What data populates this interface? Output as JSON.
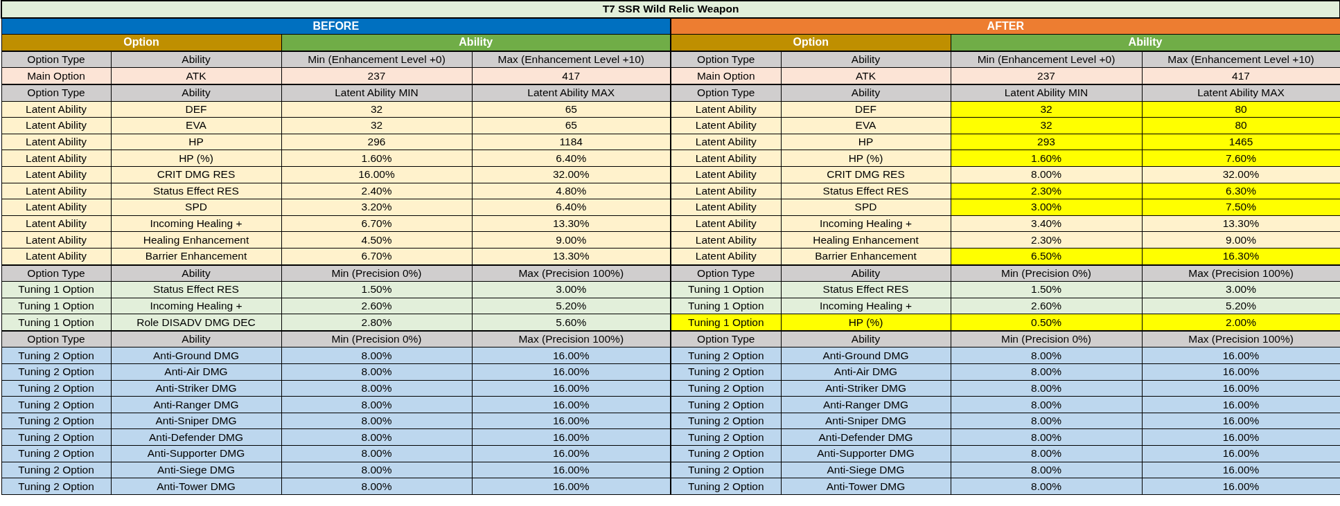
{
  "title": "T7 SSR Wild Relic Weapon",
  "panels": [
    {
      "label": "BEFORE",
      "color": "#0070c0",
      "groups": [
        {
          "label": "Option",
          "kind": "option"
        },
        {
          "label": "Ability",
          "kind": "ability"
        }
      ],
      "sections": [
        {
          "kind": "main",
          "header": [
            "Option Type",
            "Ability",
            "Min (Enhancement Level +0)",
            "Max (Enhancement Level +10)"
          ],
          "rows": [
            {
              "cells": [
                "Main Option",
                "ATK",
                "237",
                "417"
              ],
              "labels_highlighted": false,
              "values_highlighted": false
            }
          ]
        },
        {
          "kind": "latent",
          "header": [
            "Option Type",
            "Ability",
            "Latent Ability MIN",
            "Latent Ability MAX"
          ],
          "rows": [
            {
              "cells": [
                "Latent Ability",
                "DEF",
                "32",
                "65"
              ],
              "labels_highlighted": false,
              "values_highlighted": false
            },
            {
              "cells": [
                "Latent Ability",
                "EVA",
                "32",
                "65"
              ],
              "labels_highlighted": false,
              "values_highlighted": false
            },
            {
              "cells": [
                "Latent Ability",
                "HP",
                "296",
                "1184"
              ],
              "labels_highlighted": false,
              "values_highlighted": false
            },
            {
              "cells": [
                "Latent Ability",
                "HP (%)",
                "1.60%",
                "6.40%"
              ],
              "labels_highlighted": false,
              "values_highlighted": false
            },
            {
              "cells": [
                "Latent Ability",
                "CRIT DMG RES",
                "16.00%",
                "32.00%"
              ],
              "labels_highlighted": false,
              "values_highlighted": false
            },
            {
              "cells": [
                "Latent Ability",
                "Status Effect RES",
                "2.40%",
                "4.80%"
              ],
              "labels_highlighted": false,
              "values_highlighted": false
            },
            {
              "cells": [
                "Latent Ability",
                "SPD",
                "3.20%",
                "6.40%"
              ],
              "labels_highlighted": false,
              "values_highlighted": false
            },
            {
              "cells": [
                "Latent Ability",
                "Incoming Healing +",
                "6.70%",
                "13.30%"
              ],
              "labels_highlighted": false,
              "values_highlighted": false
            },
            {
              "cells": [
                "Latent Ability",
                "Healing Enhancement",
                "4.50%",
                "9.00%"
              ],
              "labels_highlighted": false,
              "values_highlighted": false
            },
            {
              "cells": [
                "Latent Ability",
                "Barrier Enhancement",
                "6.70%",
                "13.30%"
              ],
              "labels_highlighted": false,
              "values_highlighted": false
            }
          ]
        },
        {
          "kind": "tuning1",
          "header": [
            "Option Type",
            "Ability",
            "Min (Precision 0%)",
            "Max (Precision 100%)"
          ],
          "rows": [
            {
              "cells": [
                "Tuning 1 Option",
                "Status Effect RES",
                "1.50%",
                "3.00%"
              ],
              "labels_highlighted": false,
              "values_highlighted": false
            },
            {
              "cells": [
                "Tuning 1 Option",
                "Incoming Healing +",
                "2.60%",
                "5.20%"
              ],
              "labels_highlighted": false,
              "values_highlighted": false
            },
            {
              "cells": [
                "Tuning 1 Option",
                "Role DISADV DMG DEC",
                "2.80%",
                "5.60%"
              ],
              "labels_highlighted": false,
              "values_highlighted": false
            }
          ]
        },
        {
          "kind": "tuning2",
          "header": [
            "Option Type",
            "Ability",
            "Min (Precision 0%)",
            "Max (Precision 100%)"
          ],
          "rows": [
            {
              "cells": [
                "Tuning 2 Option",
                "Anti-Ground DMG",
                "8.00%",
                "16.00%"
              ],
              "labels_highlighted": false,
              "values_highlighted": false
            },
            {
              "cells": [
                "Tuning 2 Option",
                "Anti-Air DMG",
                "8.00%",
                "16.00%"
              ],
              "labels_highlighted": false,
              "values_highlighted": false
            },
            {
              "cells": [
                "Tuning 2 Option",
                "Anti-Striker DMG",
                "8.00%",
                "16.00%"
              ],
              "labels_highlighted": false,
              "values_highlighted": false
            },
            {
              "cells": [
                "Tuning 2 Option",
                "Anti-Ranger DMG",
                "8.00%",
                "16.00%"
              ],
              "labels_highlighted": false,
              "values_highlighted": false
            },
            {
              "cells": [
                "Tuning 2 Option",
                "Anti-Sniper DMG",
                "8.00%",
                "16.00%"
              ],
              "labels_highlighted": false,
              "values_highlighted": false
            },
            {
              "cells": [
                "Tuning 2 Option",
                "Anti-Defender DMG",
                "8.00%",
                "16.00%"
              ],
              "labels_highlighted": false,
              "values_highlighted": false
            },
            {
              "cells": [
                "Tuning 2 Option",
                "Anti-Supporter DMG",
                "8.00%",
                "16.00%"
              ],
              "labels_highlighted": false,
              "values_highlighted": false
            },
            {
              "cells": [
                "Tuning 2 Option",
                "Anti-Siege DMG",
                "8.00%",
                "16.00%"
              ],
              "labels_highlighted": false,
              "values_highlighted": false
            },
            {
              "cells": [
                "Tuning 2 Option",
                "Anti-Tower DMG",
                "8.00%",
                "16.00%"
              ],
              "labels_highlighted": false,
              "values_highlighted": false
            }
          ]
        }
      ]
    },
    {
      "label": "AFTER",
      "color": "#ed7d31",
      "groups": [
        {
          "label": "Option",
          "kind": "option"
        },
        {
          "label": "Ability",
          "kind": "ability"
        }
      ],
      "sections": [
        {
          "kind": "main",
          "header": [
            "Option Type",
            "Ability",
            "Min (Enhancement Level +0)",
            "Max (Enhancement Level +10)"
          ],
          "rows": [
            {
              "cells": [
                "Main Option",
                "ATK",
                "237",
                "417"
              ],
              "labels_highlighted": false,
              "values_highlighted": false
            }
          ]
        },
        {
          "kind": "latent",
          "header": [
            "Option Type",
            "Ability",
            "Latent Ability MIN",
            "Latent Ability MAX"
          ],
          "rows": [
            {
              "cells": [
                "Latent Ability",
                "DEF",
                "32",
                "80"
              ],
              "labels_highlighted": false,
              "values_highlighted": true
            },
            {
              "cells": [
                "Latent Ability",
                "EVA",
                "32",
                "80"
              ],
              "labels_highlighted": false,
              "values_highlighted": true
            },
            {
              "cells": [
                "Latent Ability",
                "HP",
                "293",
                "1465"
              ],
              "labels_highlighted": false,
              "values_highlighted": true
            },
            {
              "cells": [
                "Latent Ability",
                "HP (%)",
                "1.60%",
                "7.60%"
              ],
              "labels_highlighted": false,
              "values_highlighted": true
            },
            {
              "cells": [
                "Latent Ability",
                "CRIT DMG RES",
                "8.00%",
                "32.00%"
              ],
              "labels_highlighted": false,
              "values_highlighted": false
            },
            {
              "cells": [
                "Latent Ability",
                "Status Effect RES",
                "2.30%",
                "6.30%"
              ],
              "labels_highlighted": false,
              "values_highlighted": true
            },
            {
              "cells": [
                "Latent Ability",
                "SPD",
                "3.00%",
                "7.50%"
              ],
              "labels_highlighted": false,
              "values_highlighted": true
            },
            {
              "cells": [
                "Latent Ability",
                "Incoming Healing +",
                "3.40%",
                "13.30%"
              ],
              "labels_highlighted": false,
              "values_highlighted": false
            },
            {
              "cells": [
                "Latent Ability",
                "Healing Enhancement",
                "2.30%",
                "9.00%"
              ],
              "labels_highlighted": false,
              "values_highlighted": false
            },
            {
              "cells": [
                "Latent Ability",
                "Barrier Enhancement",
                "6.50%",
                "16.30%"
              ],
              "labels_highlighted": false,
              "values_highlighted": true
            }
          ]
        },
        {
          "kind": "tuning1",
          "header": [
            "Option Type",
            "Ability",
            "Min (Precision 0%)",
            "Max (Precision 100%)"
          ],
          "rows": [
            {
              "cells": [
                "Tuning 1 Option",
                "Status Effect RES",
                "1.50%",
                "3.00%"
              ],
              "labels_highlighted": false,
              "values_highlighted": false
            },
            {
              "cells": [
                "Tuning 1 Option",
                "Incoming Healing +",
                "2.60%",
                "5.20%"
              ],
              "labels_highlighted": false,
              "values_highlighted": false
            },
            {
              "cells": [
                "Tuning 1 Option",
                "HP (%)",
                "0.50%",
                "2.00%"
              ],
              "labels_highlighted": true,
              "values_highlighted": true
            }
          ]
        },
        {
          "kind": "tuning2",
          "header": [
            "Option Type",
            "Ability",
            "Min (Precision 0%)",
            "Max (Precision 100%)"
          ],
          "rows": [
            {
              "cells": [
                "Tuning 2 Option",
                "Anti-Ground DMG",
                "8.00%",
                "16.00%"
              ],
              "labels_highlighted": false,
              "values_highlighted": false
            },
            {
              "cells": [
                "Tuning 2 Option",
                "Anti-Air DMG",
                "8.00%",
                "16.00%"
              ],
              "labels_highlighted": false,
              "values_highlighted": false
            },
            {
              "cells": [
                "Tuning 2 Option",
                "Anti-Striker DMG",
                "8.00%",
                "16.00%"
              ],
              "labels_highlighted": false,
              "values_highlighted": false
            },
            {
              "cells": [
                "Tuning 2 Option",
                "Anti-Ranger DMG",
                "8.00%",
                "16.00%"
              ],
              "labels_highlighted": false,
              "values_highlighted": false
            },
            {
              "cells": [
                "Tuning 2 Option",
                "Anti-Sniper DMG",
                "8.00%",
                "16.00%"
              ],
              "labels_highlighted": false,
              "values_highlighted": false
            },
            {
              "cells": [
                "Tuning 2 Option",
                "Anti-Defender DMG",
                "8.00%",
                "16.00%"
              ],
              "labels_highlighted": false,
              "values_highlighted": false
            },
            {
              "cells": [
                "Tuning 2 Option",
                "Anti-Supporter DMG",
                "8.00%",
                "16.00%"
              ],
              "labels_highlighted": false,
              "values_highlighted": false
            },
            {
              "cells": [
                "Tuning 2 Option",
                "Anti-Siege DMG",
                "8.00%",
                "16.00%"
              ],
              "labels_highlighted": false,
              "values_highlighted": false
            },
            {
              "cells": [
                "Tuning 2 Option",
                "Anti-Tower DMG",
                "8.00%",
                "16.00%"
              ],
              "labels_highlighted": false,
              "values_highlighted": false
            }
          ]
        }
      ]
    }
  ]
}
